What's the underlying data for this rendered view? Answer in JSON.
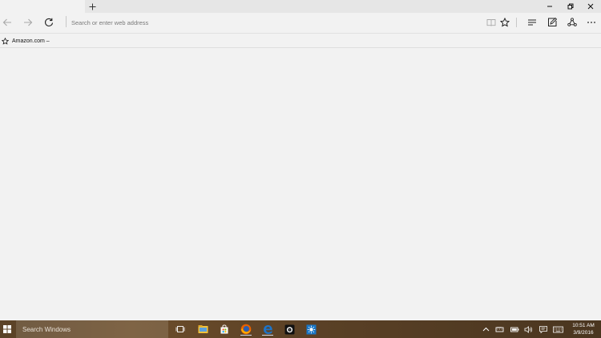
{
  "browser": {
    "address_placeholder": "Search or enter web address",
    "favorites": [
      {
        "label": "Amazon.com –"
      }
    ]
  },
  "taskbar": {
    "search_placeholder": "Search Windows",
    "clock": {
      "time": "10:51 AM",
      "date": "3/9/2016"
    },
    "apps": [
      {
        "icon": "task-view-icon"
      },
      {
        "icon": "file-explorer-icon"
      },
      {
        "icon": "store-icon"
      },
      {
        "icon": "firefox-icon"
      },
      {
        "icon": "edge-icon"
      },
      {
        "icon": "camera-app-icon"
      },
      {
        "icon": "blue-app-icon"
      }
    ]
  },
  "colors": {
    "page_bg": "#f2f2f2",
    "titlebar_bg": "#e6e6e6",
    "taskbar_bg": "#5a4227",
    "edge_blue": "#1e74c8",
    "firefox_orange": "#e66000"
  }
}
